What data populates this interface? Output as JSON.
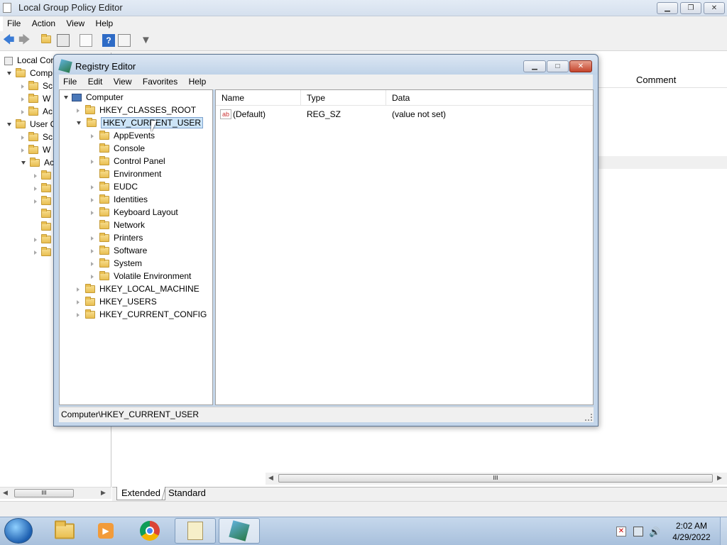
{
  "gpe": {
    "title": "Local Group Policy Editor",
    "menu": [
      "File",
      "Action",
      "View",
      "Help"
    ],
    "tree_root": "Local Cor",
    "tree_items": [
      {
        "label": "Comp",
        "level": 1,
        "expanded": true
      },
      {
        "label": "Sc",
        "level": 2
      },
      {
        "label": "W",
        "level": 2
      },
      {
        "label": "Ac",
        "level": 2
      },
      {
        "label": "User C",
        "level": 1,
        "expanded": true
      },
      {
        "label": "Sc",
        "level": 2
      },
      {
        "label": "W",
        "level": 2
      },
      {
        "label": "Ac",
        "level": 2,
        "expanded": true
      }
    ],
    "comment_header": "Comment",
    "tabs": [
      "Extended",
      "Standard"
    ],
    "scroll_glyph": "III"
  },
  "regedit": {
    "title": "Registry Editor",
    "menu": [
      "File",
      "Edit",
      "View",
      "Favorites",
      "Help"
    ],
    "tree": {
      "root": "Computer",
      "hives": [
        {
          "label": "HKEY_CLASSES_ROOT"
        },
        {
          "label": "HKEY_CURRENT_USER",
          "selected": true,
          "children": [
            {
              "label": "AppEvents",
              "expandable": true
            },
            {
              "label": "Console",
              "expandable": false
            },
            {
              "label": "Control Panel",
              "expandable": true
            },
            {
              "label": "Environment",
              "expandable": false
            },
            {
              "label": "EUDC",
              "expandable": true
            },
            {
              "label": "Identities",
              "expandable": true
            },
            {
              "label": "Keyboard Layout",
              "expandable": true
            },
            {
              "label": "Network",
              "expandable": false
            },
            {
              "label": "Printers",
              "expandable": true
            },
            {
              "label": "Software",
              "expandable": true
            },
            {
              "label": "System",
              "expandable": true
            },
            {
              "label": "Volatile Environment",
              "expandable": true
            }
          ]
        },
        {
          "label": "HKEY_LOCAL_MACHINE"
        },
        {
          "label": "HKEY_USERS"
        },
        {
          "label": "HKEY_CURRENT_CONFIG"
        }
      ]
    },
    "columns": [
      "Name",
      "Type",
      "Data"
    ],
    "values": [
      {
        "name": "(Default)",
        "type": "REG_SZ",
        "data": "(value not set)",
        "icon": "ab"
      }
    ],
    "status": "Computer\\HKEY_CURRENT_USER"
  },
  "taskbar": {
    "time": "2:02 AM",
    "date": "4/29/2022"
  },
  "colors": {
    "accent": "#3a6ea5",
    "taskbar": "#b9cde3",
    "selection": "#cce4f7"
  }
}
